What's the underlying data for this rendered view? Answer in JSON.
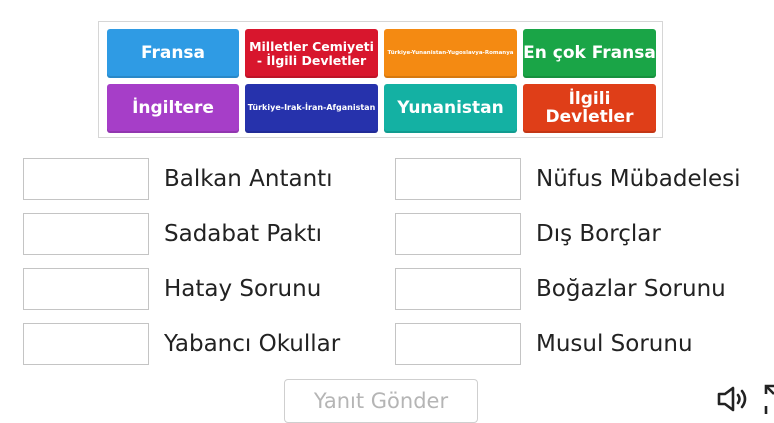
{
  "tiles": [
    {
      "label": "Fransa"
    },
    {
      "label": "Milletler Cemiyeti - İlgili Devletler"
    },
    {
      "label": "Türkiye-Yunanistan-Yugoslavya-Romanya"
    },
    {
      "label": "En çok Fransa"
    },
    {
      "label": "İngiltere"
    },
    {
      "label": "Türkiye-Irak-İran-Afganistan"
    },
    {
      "label": "Yunanistan"
    },
    {
      "label": "İlgili Devletler"
    }
  ],
  "targets": {
    "left": [
      "Balkan Antantı",
      "Sadabat Paktı",
      "Hatay Sorunu",
      "Yabancı Okullar"
    ],
    "right": [
      "Nüfus Mübadelesi",
      "Dış Borçlar",
      "Boğazlar Sorunu",
      "Musul Sorunu"
    ]
  },
  "submit_label": "Yanıt Gönder",
  "icons": {
    "audio": "speaker-icon",
    "fullscreen": "fullscreen-icon"
  },
  "colors": {
    "tile_blue": "#2f9be4",
    "tile_red": "#d8162d",
    "tile_orange": "#f48a12",
    "tile_green": "#1aa547",
    "tile_purple": "#a63ec8",
    "tile_navy": "#2632ac",
    "tile_teal": "#14b1a3",
    "tile_redorange": "#df3e18"
  }
}
